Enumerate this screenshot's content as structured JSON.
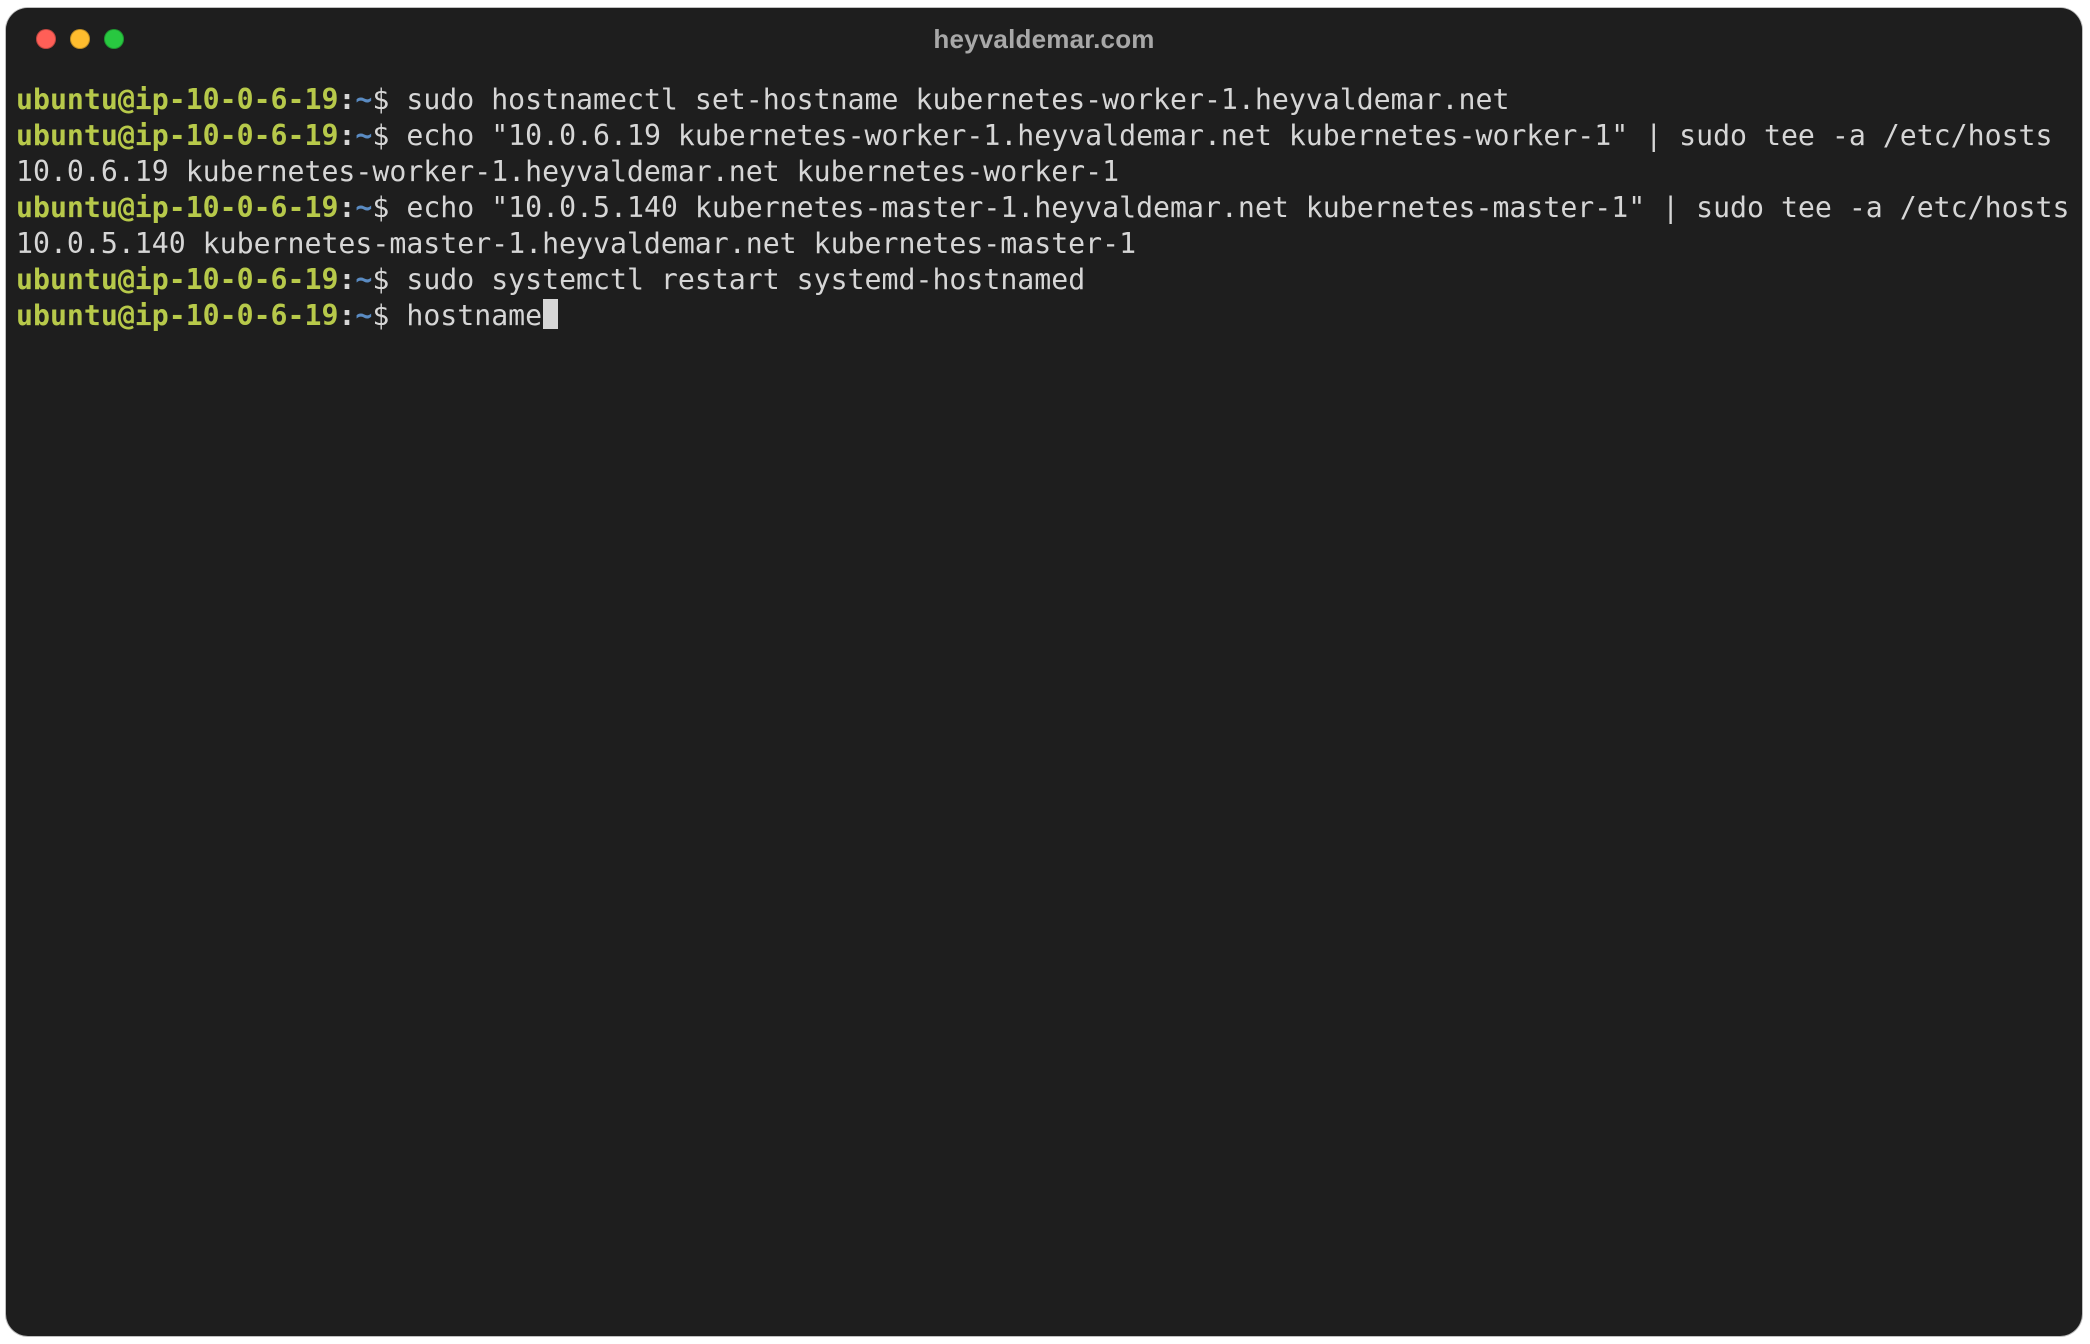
{
  "window": {
    "title": "heyvaldemar.com"
  },
  "prompt": {
    "user_host": "ubuntu@ip-10-0-6-19",
    "sep": ":",
    "path": "~",
    "symbol": "$"
  },
  "colors": {
    "background": "#1e1e1e",
    "text": "#d6d6d6",
    "prompt_user": "#b7c94a",
    "prompt_path": "#5a8bc2",
    "traffic_red": "#ff5f57",
    "traffic_yellow": "#febc2e",
    "traffic_green": "#28c840"
  },
  "lines": [
    {
      "type": "cmd",
      "text": "sudo hostnamectl set-hostname kubernetes-worker-1.heyvaldemar.net"
    },
    {
      "type": "cmd",
      "text": "echo \"10.0.6.19 kubernetes-worker-1.heyvaldemar.net kubernetes-worker-1\" | sudo tee -a /etc/hosts"
    },
    {
      "type": "out",
      "text": "10.0.6.19 kubernetes-worker-1.heyvaldemar.net kubernetes-worker-1"
    },
    {
      "type": "cmd",
      "text": "echo \"10.0.5.140 kubernetes-master-1.heyvaldemar.net kubernetes-master-1\" | sudo tee -a /etc/hosts"
    },
    {
      "type": "out",
      "text": "10.0.5.140 kubernetes-master-1.heyvaldemar.net kubernetes-master-1"
    },
    {
      "type": "cmd",
      "text": "sudo systemctl restart systemd-hostnamed"
    },
    {
      "type": "cmd",
      "text": "hostname",
      "cursor": true
    }
  ]
}
